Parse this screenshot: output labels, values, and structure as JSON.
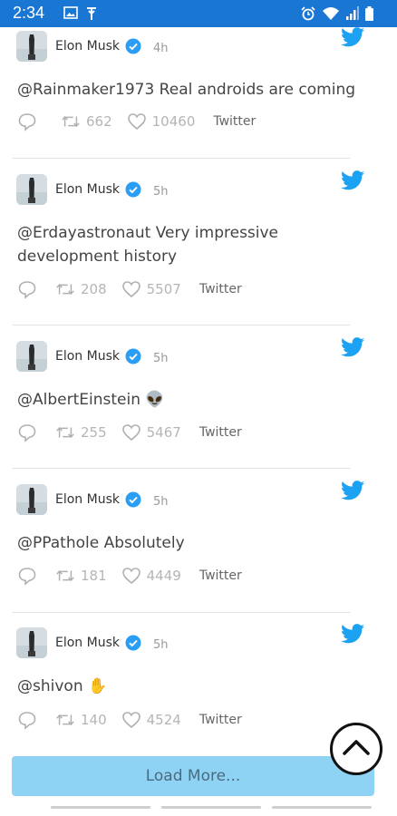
{
  "status_bar": {
    "time": "2:34",
    "left_icons": [
      "image-icon",
      "antenna-icon"
    ],
    "right_icons": [
      "alarm-icon",
      "wifi-icon",
      "signal-icon",
      "battery-icon"
    ]
  },
  "tweets": [
    {
      "author": "Elon Musk",
      "time": "4h",
      "text": "@Rainmaker1973 Real androids are coming",
      "retweets": "662",
      "likes": "10460",
      "source": "Twitter"
    },
    {
      "author": "Elon Musk",
      "time": "5h",
      "text": "@Erdayastronaut Very impressive development history",
      "retweets": "208",
      "likes": "5507",
      "source": "Twitter"
    },
    {
      "author": "Elon Musk",
      "time": "5h",
      "text": "@AlbertEinstein 👽",
      "retweets": "255",
      "likes": "5467",
      "source": "Twitter"
    },
    {
      "author": "Elon Musk",
      "time": "5h",
      "text": "@PPathole Absolutely",
      "retweets": "181",
      "likes": "4449",
      "source": "Twitter"
    },
    {
      "author": "Elon Musk",
      "time": "5h",
      "text": "@shivon ✋",
      "retweets": "140",
      "likes": "4524",
      "source": "Twitter"
    }
  ],
  "load_more_label": "Load More...",
  "colors": {
    "status_bar": "#1976d2",
    "twitter_blue": "#1da1f2",
    "load_more_bg": "#8fd3f4"
  }
}
